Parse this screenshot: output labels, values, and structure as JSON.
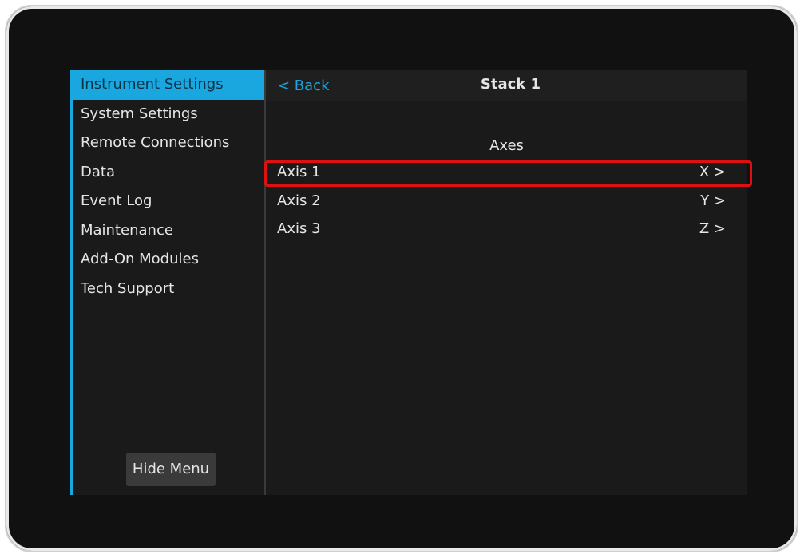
{
  "sidebar": {
    "items": [
      {
        "label": "Instrument Settings"
      },
      {
        "label": "System Settings"
      },
      {
        "label": "Remote Connections"
      },
      {
        "label": "Data"
      },
      {
        "label": "Event Log"
      },
      {
        "label": "Maintenance"
      },
      {
        "label": "Add-On Modules"
      },
      {
        "label": "Tech Support"
      }
    ],
    "hide_menu_label": "Hide Menu"
  },
  "header": {
    "back_label": "< Back",
    "title": "Stack 1"
  },
  "main": {
    "section_title": "Axes",
    "axes": [
      {
        "label": "Axis 1",
        "value": "X >"
      },
      {
        "label": "Axis 2",
        "value": "Y >"
      },
      {
        "label": "Axis 3",
        "value": "Z >"
      }
    ]
  },
  "colors": {
    "accent": "#1aa6df",
    "highlight": "#e11010",
    "background": "#1a1a1a"
  }
}
